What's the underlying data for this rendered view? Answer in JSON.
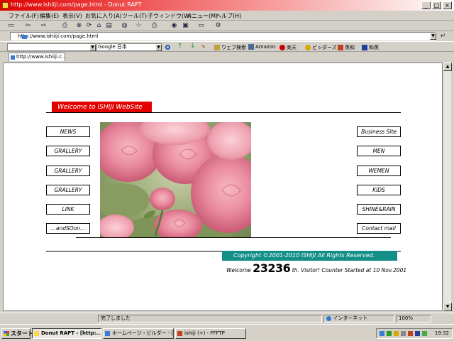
{
  "window": {
    "title": "http://www.ishiiji.com/page.html - Donut RAPT"
  },
  "menu": [
    "ファイル(F)",
    "編集(E)",
    "表示(V)",
    "お気に入り(A)",
    "ツール(T)",
    "子ウィンドウ(W)",
    "メニュー(M)",
    "ヘルプ(H)"
  ],
  "address": {
    "url": "http://www.ishiiji.com/page.html"
  },
  "search": {
    "engine": "Google 日本",
    "links": [
      "ウェブ検索",
      "Amazon",
      "楽天",
      "ビッダーズ",
      "英和",
      "和英"
    ]
  },
  "tab": {
    "label": "http://www.ishiiji.c..."
  },
  "page": {
    "welcome": "Welcome to ISHIJI WebSite",
    "left_nav": [
      "NEWS",
      "GRALLERY",
      "GRALLERY",
      "GRALLERY",
      "LINK",
      "...andSOon..."
    ],
    "right_nav": [
      "Business Site",
      "MEN",
      "WEMEN",
      "KIDS",
      "SHINE&RAIN",
      "Contact mail"
    ],
    "copyright": "Copyright ©2001-2010   ISHIJI All Rights Reserved.",
    "counter_prefix": "Welcome",
    "counter_value": "23236",
    "counter_suffix": "th. Visitor!   Counter Started at 10 Nov.2001"
  },
  "status": {
    "text": "完了しました",
    "zone": "インターネット",
    "zoom": "100%"
  },
  "taskbar": {
    "start": "スタート",
    "items": [
      "Donut RAPT - [http:...",
      "ホームページ・ビルダー - [...",
      "ishiji (+) - FFFTP"
    ],
    "clock": "19:32"
  },
  "colors": {
    "accent_red": "#e50000",
    "teal": "#138f88"
  }
}
